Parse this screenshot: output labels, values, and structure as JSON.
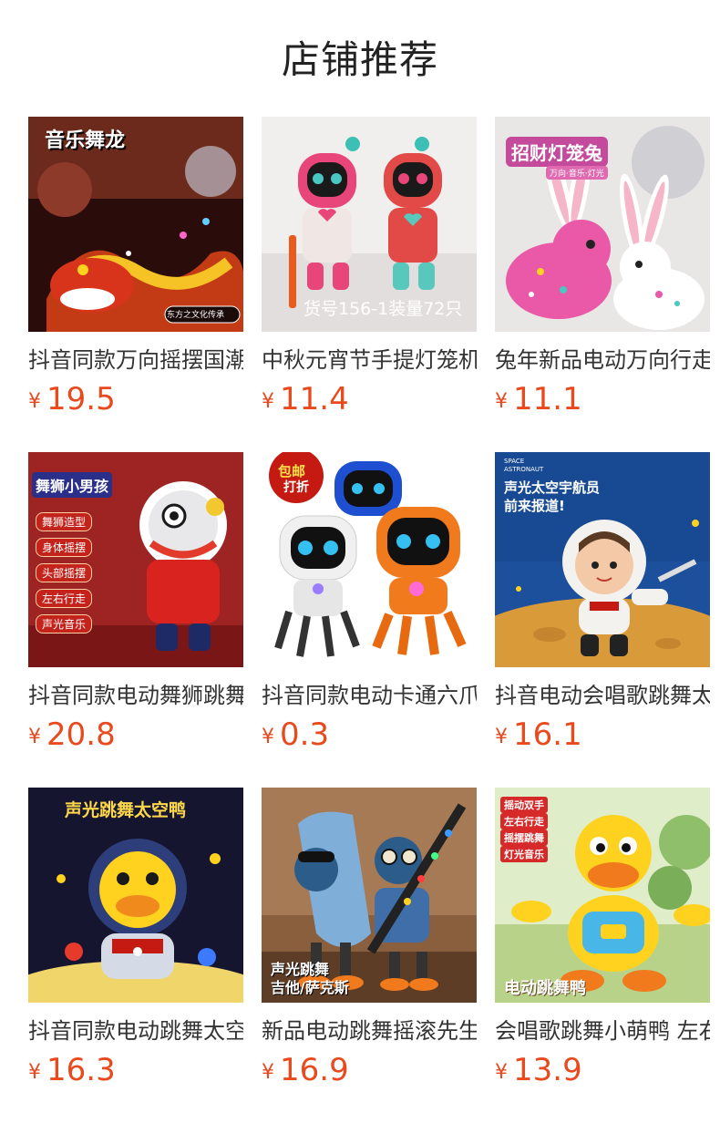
{
  "header": {
    "title": "店铺推荐"
  },
  "currency": "¥",
  "products": [
    {
      "name": "抖音同款万向摇摆国潮舞龙",
      "price": "19.5",
      "image_text": [
        "音乐舞龙",
        "东方之文化传承"
      ]
    },
    {
      "name": "中秋元宵节手提灯笼机器人",
      "price": "11.4",
      "image_text": [
        "货号156-1装量72只"
      ]
    },
    {
      "name": "兔年新品电动万向行走兔",
      "price": "11.1",
      "image_text": [
        "招财灯笼兔",
        "万向·音乐·灯光"
      ]
    },
    {
      "name": "抖音同款电动舞狮跳舞玩具",
      "price": "20.8",
      "image_text": [
        "舞狮小男孩",
        "舞狮造型",
        "身体摇摆",
        "头部摇摆",
        "左右行走",
        "声光音乐"
      ]
    },
    {
      "name": "抖音同款电动卡通六爪机器人",
      "price": "0.3",
      "image_text": [
        "包邮",
        "打折"
      ]
    },
    {
      "name": "抖音电动会唱歌跳舞太空人",
      "price": "16.1",
      "image_text": [
        "SPACE ASTRONAUT",
        "声光太空宇航员",
        "前来报道!"
      ]
    },
    {
      "name": "抖音同款电动跳舞太空鸭",
      "price": "16.3",
      "image_text": [
        "声光跳舞太空鸭"
      ]
    },
    {
      "name": "新品电动跳舞摇滚先生",
      "price": "16.9",
      "image_text": [
        "声光跳舞",
        "吉他/萨克斯"
      ]
    },
    {
      "name": "会唱歌跳舞小萌鸭 左右摇摆",
      "price": "13.9",
      "image_text": [
        "摇动双手",
        "左右行走",
        "摇摆跳舞",
        "灯光音乐",
        "电动跳舞鸭"
      ]
    }
  ]
}
